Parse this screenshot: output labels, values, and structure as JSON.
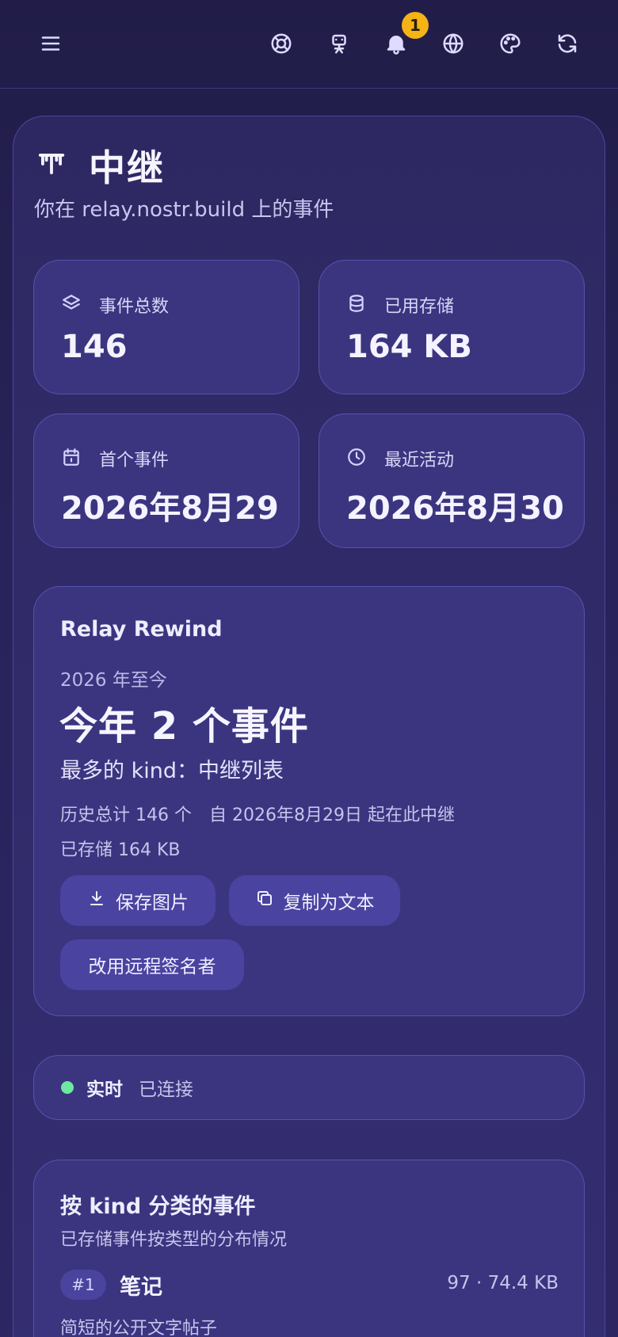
{
  "header": {
    "icons": [
      "menu-icon",
      "lifebuoy-icon",
      "robot-icon",
      "bell-icon",
      "globe-icon",
      "palette-icon",
      "refresh-icon"
    ],
    "notification_count": "1",
    "badge_color": "#f5b316"
  },
  "page": {
    "title": "中继",
    "subtitle": "你在 relay.nostr.build 上的事件"
  },
  "stats": [
    {
      "icon": "layers-icon",
      "label": "事件总数",
      "value": "146"
    },
    {
      "icon": "database-icon",
      "label": "已用存储",
      "value": "164 KB"
    },
    {
      "icon": "calendar-icon",
      "label": "首个事件",
      "value": "2026年8月29"
    },
    {
      "icon": "clock-icon",
      "label": "最近活动",
      "value": "2026年8月30"
    }
  ],
  "rewind": {
    "title": "Relay Rewind",
    "since": "2026 年至今",
    "headline": "今年 2 个事件",
    "top_kind": "最多的 kind：中继列表",
    "history": "历史总计 146 个　自 2026年8月29日 起在此中继",
    "stored": "已存储 164 KB",
    "save_image": "保存图片",
    "copy_text": "复制为文本",
    "remote_signer": "改用远程签名者"
  },
  "live": {
    "label": "实时",
    "status": "已连接",
    "status_color": "#6ee7a0"
  },
  "kinds": {
    "title": "按 kind 分类的事件",
    "subtitle": "已存储事件按类型的分布情况",
    "items": [
      {
        "rank": "#1",
        "name": "笔记",
        "meta": "97 · 74.4 KB",
        "desc": "简短的公开文字帖子"
      }
    ]
  }
}
